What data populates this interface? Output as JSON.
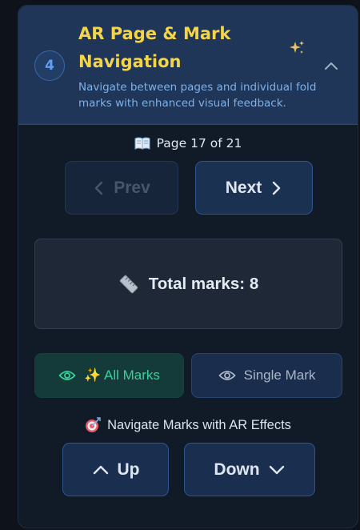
{
  "section": {
    "step_number": "4",
    "title": "AR Page & Mark Navigation",
    "description": "Navigate between pages and individual fold marks with enhanced visual feedback."
  },
  "pagination": {
    "page_label": "Page 17 of 21",
    "current_page": 17,
    "total_pages": 21,
    "prev_label": "Prev",
    "next_label": "Next"
  },
  "marks": {
    "total_label": "Total marks: 8",
    "count": 8,
    "all_marks_label": "✨ All Marks",
    "single_mark_label": "Single Mark",
    "selected_mode": "All Marks"
  },
  "mark_navigation": {
    "label": "Navigate Marks with AR Effects",
    "up_label": "Up",
    "down_label": "Down"
  },
  "icons": {
    "header": [
      "sparkles-icon",
      "chevron-up-icon"
    ],
    "page": "book-icon",
    "total": "ruler-icon",
    "modes": [
      "eye-icon",
      "eye-icon"
    ],
    "nav": "target-icon"
  },
  "colors": {
    "title": "#f5d547",
    "accent_blue": "#5fa0f0",
    "active_green": "#34d399",
    "panel_bg": "#111a27",
    "header_bg": "#1f3658"
  }
}
